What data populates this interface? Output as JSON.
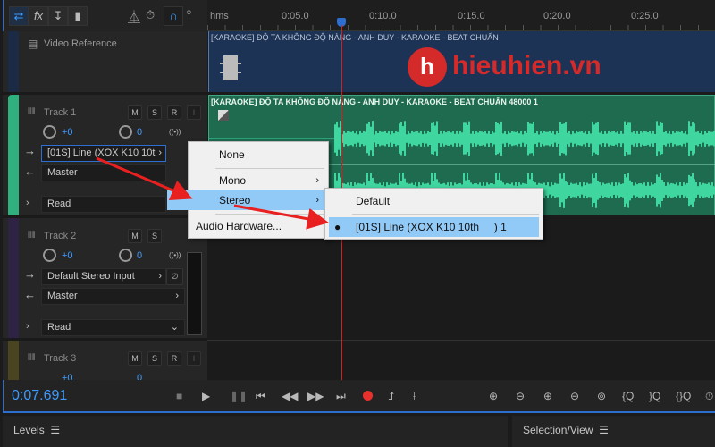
{
  "toolbar": {
    "icons": [
      "swap-icon",
      "fx-icon",
      "send-icon",
      "levels-icon",
      "metronome-icon",
      "time-stretch-icon",
      "snap-magnet-icon",
      "marker-pin-icon"
    ]
  },
  "ruler": {
    "labels": [
      "hms",
      "0:05.0",
      "0:10.0",
      "0:15.0",
      "0:20.0",
      "0:25.0"
    ]
  },
  "video": {
    "label": "Video Reference",
    "clip_title": "[KARAOKE] ĐỘ TA KHÔNG ĐỘ NÀNG - ANH DUY - KARAOKE - BEAT CHUẨN"
  },
  "watermark": "hieuhien.vn",
  "tracks": [
    {
      "name": "Track 1",
      "volume": "+0",
      "pan": "0",
      "input": "[01S] Line (XOX K10 10t",
      "output": "Master",
      "automation": "Read",
      "color": "#2fb07e",
      "clip_title": "[KARAOKE] ĐỘ TA KHÔNG ĐỘ NÀNG - ANH DUY - KARAOKE - BEAT CHUẨN 48000 1"
    },
    {
      "name": "Track 2",
      "volume": "+0",
      "pan": "0",
      "input": "Default Stereo Input",
      "output": "Master",
      "automation": "Read",
      "color": "#2e2245"
    },
    {
      "name": "Track 3",
      "volume": "+0",
      "pan": "0",
      "color": "#4a4520"
    }
  ],
  "buttons": {
    "mute": "M",
    "solo": "S",
    "record": "R",
    "input": "I"
  },
  "context_menu": {
    "items": [
      "None",
      "Mono",
      "Stereo",
      "Audio Hardware..."
    ],
    "selected": "Stereo"
  },
  "submenu": {
    "items": [
      "Default",
      "[01S] Line (XOX K10 10th     ) 1"
    ],
    "selected": "[01S] Line (XOX K10 10th     ) 1"
  },
  "transport": {
    "time": "0:07.691",
    "record_color": "#e8302c"
  },
  "panels": {
    "levels": "Levels",
    "selection": "Selection/View"
  },
  "colors": {
    "accent": "#2d6fd0",
    "playhead": "#d42020",
    "waveform": "#3fd6a0",
    "clip_green": "#1e6b50",
    "clip_video": "#1d3355"
  }
}
